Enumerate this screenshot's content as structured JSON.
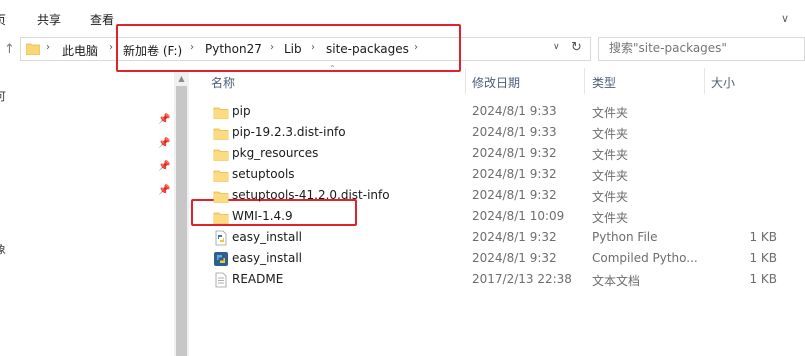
{
  "ribbon": {
    "edge_label": "页",
    "tabs": [
      "共享",
      "查看"
    ]
  },
  "address_bar": {
    "breadcrumbs": [
      "此电脑",
      "新加卷 (F:)",
      "Python27",
      "Lib",
      "site-packages"
    ]
  },
  "search": {
    "placeholder": "搜索\"site-packages\""
  },
  "nav_pane": {
    "edge_chars": [
      "可",
      "象"
    ]
  },
  "columns": {
    "name": "名称",
    "date": "修改日期",
    "type": "类型",
    "size": "大小"
  },
  "files": [
    {
      "name": "pip",
      "date": "2024/8/1 9:33",
      "type": "文件夹",
      "size": "",
      "icon": "folder-icon"
    },
    {
      "name": "pip-19.2.3.dist-info",
      "date": "2024/8/1 9:33",
      "type": "文件夹",
      "size": "",
      "icon": "folder-icon"
    },
    {
      "name": "pkg_resources",
      "date": "2024/8/1 9:32",
      "type": "文件夹",
      "size": "",
      "icon": "folder-icon"
    },
    {
      "name": "setuptools",
      "date": "2024/8/1 9:32",
      "type": "文件夹",
      "size": "",
      "icon": "folder-icon"
    },
    {
      "name": "setuptools-41.2.0.dist-info",
      "date": "2024/8/1 9:32",
      "type": "文件夹",
      "size": "",
      "icon": "folder-icon"
    },
    {
      "name": "WMI-1.4.9",
      "date": "2024/8/1 10:09",
      "type": "文件夹",
      "size": "",
      "icon": "folder-icon"
    },
    {
      "name": "easy_install",
      "date": "2024/8/1 9:32",
      "type": "Python File",
      "size": "1 KB",
      "icon": "python-file-icon"
    },
    {
      "name": "easy_install",
      "date": "2024/8/1 9:32",
      "type": "Compiled Pytho...",
      "size": "1 KB",
      "icon": "python-compiled-icon"
    },
    {
      "name": "README",
      "date": "2017/2/13 22:38",
      "type": "文本文档",
      "size": "1 KB",
      "icon": "text-document-icon"
    }
  ],
  "colors": {
    "folder": "#f8d775",
    "folder_dark": "#e8b945",
    "highlight": "#e0222d",
    "header_text": "#4c607a"
  }
}
